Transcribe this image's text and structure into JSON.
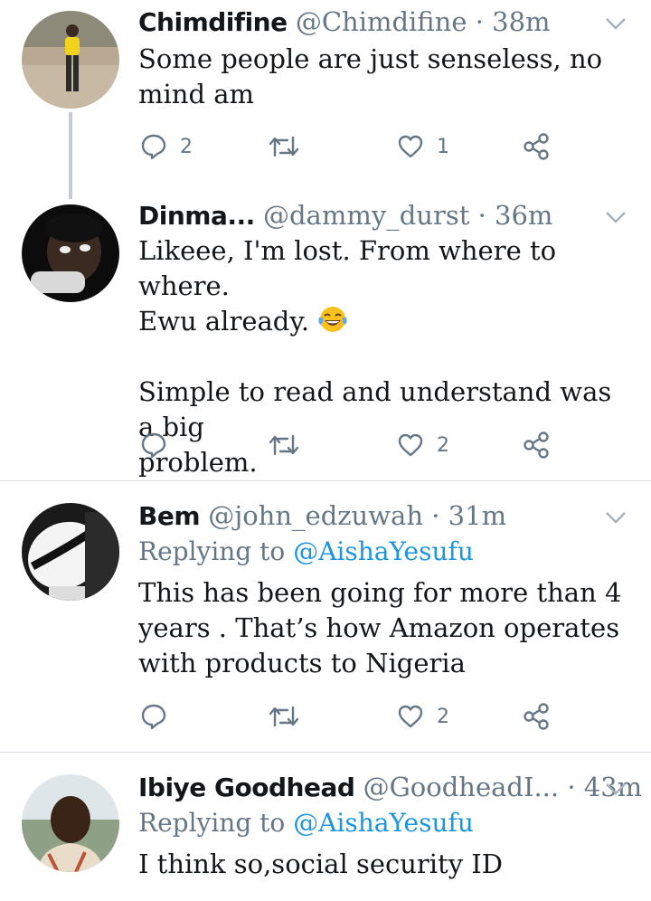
{
  "tweets": [
    {
      "name": "Chimdifine",
      "handle": "@Chimdifine",
      "dot": "·",
      "time": "38m",
      "replying_prefix": "",
      "replying_mention": "",
      "text_lines": [
        "Some people are just senseless, no",
        "mind am"
      ],
      "replies": "2",
      "retweets": "",
      "likes": "1"
    },
    {
      "name": "Dinma...",
      "handle": "@dammy_durst",
      "dot": "·",
      "time": "36m",
      "replying_prefix": "",
      "replying_mention": "",
      "text_lines": [
        "Likeee, I'm lost. From where to where.",
        "Ewu already.",
        "",
        "Simple to read and understand was a big",
        "problem."
      ],
      "emoji": "face-with-tears-of-joy",
      "replies": "",
      "retweets": "",
      "likes": "2"
    },
    {
      "name": "Bem",
      "handle": "@john_edzuwah",
      "dot": "·",
      "time": "31m",
      "replying_prefix": "Replying to",
      "replying_mention": "@AishaYesufu",
      "text_lines": [
        "This has been going for more than 4",
        "years . That’s how Amazon operates",
        "with products to Nigeria"
      ],
      "replies": "",
      "retweets": "",
      "likes": "2"
    },
    {
      "name": "Ibiye Goodhead",
      "handle": "@GoodheadI...",
      "dot": "·",
      "time": "43m",
      "replying_prefix": "Replying to",
      "replying_mention": "@AishaYesufu",
      "text_lines": [
        "I think so,social security ID"
      ]
    }
  ],
  "colors": {
    "text": "#14171a",
    "muted": "#657786",
    "link": "#1b95e0",
    "divider": "#d8dde2",
    "thread": "#c5ccd3"
  }
}
